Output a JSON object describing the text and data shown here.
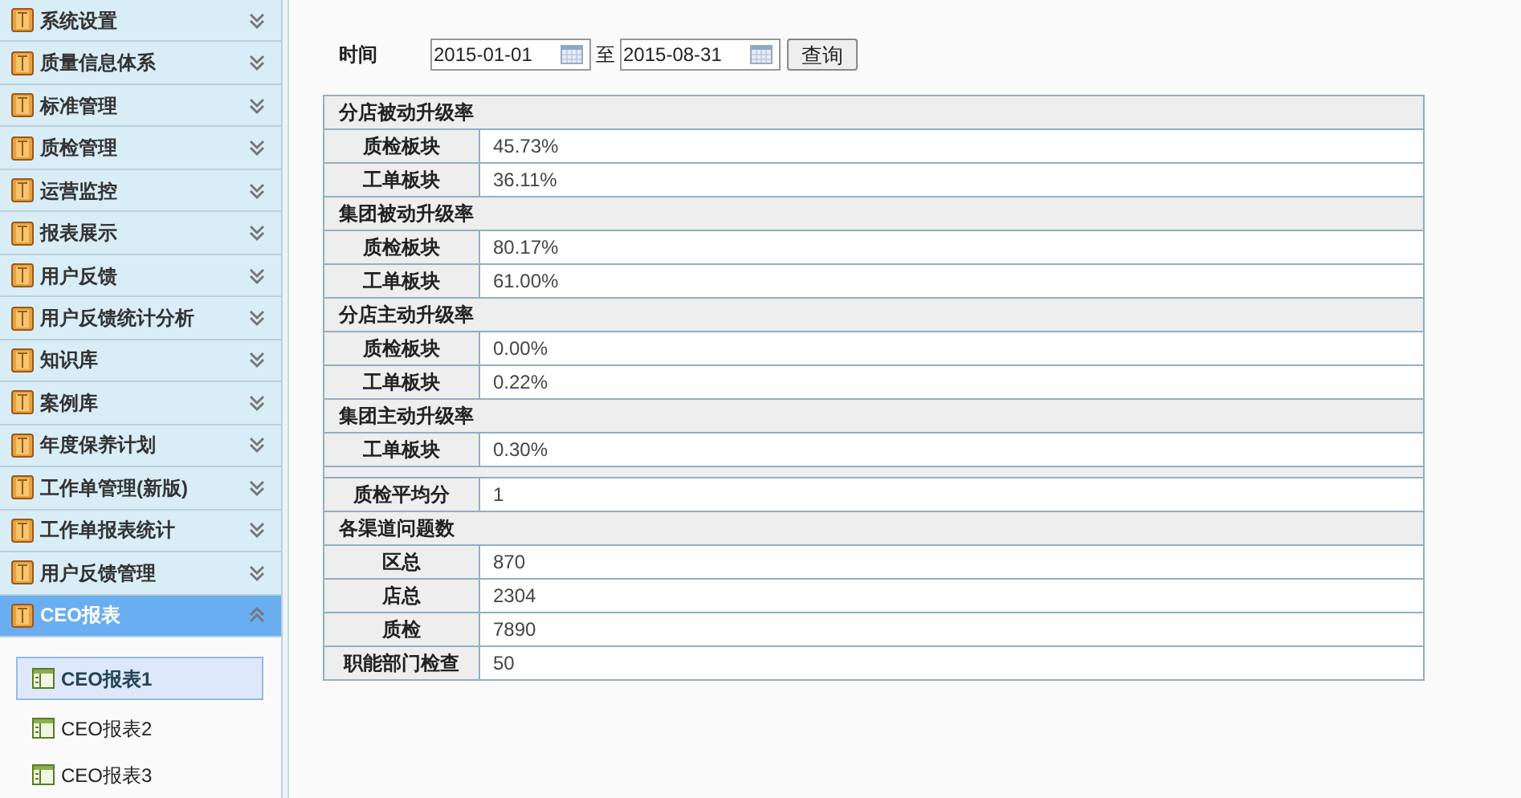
{
  "sidebar": {
    "menus": [
      {
        "label": "系统设置",
        "expanded": false
      },
      {
        "label": "质量信息体系",
        "expanded": false
      },
      {
        "label": "标准管理",
        "expanded": false
      },
      {
        "label": "质检管理",
        "expanded": false
      },
      {
        "label": "运营监控",
        "expanded": false
      },
      {
        "label": "报表展示",
        "expanded": false
      },
      {
        "label": "用户反馈",
        "expanded": false
      },
      {
        "label": "用户反馈统计分析",
        "expanded": false
      },
      {
        "label": "知识库",
        "expanded": false
      },
      {
        "label": "案例库",
        "expanded": false
      },
      {
        "label": "年度保养计划",
        "expanded": false
      },
      {
        "label": "工作单管理(新版)",
        "expanded": false
      },
      {
        "label": "工作单报表统计",
        "expanded": false
      },
      {
        "label": "用户反馈管理",
        "expanded": false
      },
      {
        "label": "CEO报表",
        "expanded": true,
        "children": [
          {
            "label": "CEO报表1",
            "selected": true
          },
          {
            "label": "CEO报表2",
            "selected": false
          },
          {
            "label": "CEO报表3",
            "selected": false
          }
        ]
      }
    ]
  },
  "filter": {
    "label": "时间",
    "start": {
      "value": "2015-01-01"
    },
    "separator": "至",
    "end": {
      "value": "2015-08-31"
    },
    "button": "查询"
  },
  "table": {
    "rows": [
      {
        "kind": "section",
        "label": "分店被动升级率"
      },
      {
        "kind": "data",
        "label": "质检板块",
        "value": "45.73%"
      },
      {
        "kind": "data",
        "label": "工单板块",
        "value": "36.11%"
      },
      {
        "kind": "section",
        "label": "集团被动升级率"
      },
      {
        "kind": "data",
        "label": "质检板块",
        "value": "80.17%"
      },
      {
        "kind": "data",
        "label": "工单板块",
        "value": "61.00%"
      },
      {
        "kind": "section",
        "label": "分店主动升级率"
      },
      {
        "kind": "data",
        "label": "质检板块",
        "value": "0.00%"
      },
      {
        "kind": "data",
        "label": "工单板块",
        "value": "0.22%"
      },
      {
        "kind": "section",
        "label": "集团主动升级率"
      },
      {
        "kind": "data",
        "label": "工单板块",
        "value": "0.30%"
      },
      {
        "kind": "spacer"
      },
      {
        "kind": "data",
        "label": "质检平均分",
        "value": "1"
      },
      {
        "kind": "section",
        "label": "各渠道问题数"
      },
      {
        "kind": "data",
        "label": "区总",
        "value": "870"
      },
      {
        "kind": "data",
        "label": "店总",
        "value": "2304"
      },
      {
        "kind": "data",
        "label": "质检",
        "value": "7890"
      },
      {
        "kind": "data",
        "label": "职能部门检查",
        "value": "50"
      }
    ]
  }
}
